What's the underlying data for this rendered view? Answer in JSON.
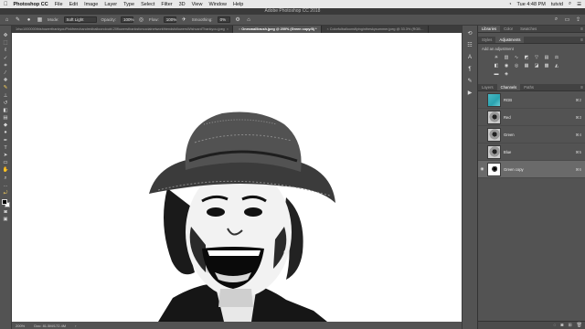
{
  "menubar": {
    "app": "Photoshop CC",
    "items": [
      "File",
      "Edit",
      "Image",
      "Layer",
      "Type",
      "Select",
      "Filter",
      "3D",
      "View",
      "Window",
      "Help"
    ],
    "clock": "Tue 4:48 PM",
    "user": "tutvid"
  },
  "window": {
    "title": "Adobe Photoshop CC 2018"
  },
  "options": {
    "mode_label": "Mode:",
    "mode_value": "Soft Light",
    "opacity_label": "Opacity:",
    "opacity_value": "100%",
    "flow_label": "Flow:",
    "flow_value": "100%",
    "smoothing_label": "Smoothing:",
    "smoothing_value": "0%"
  },
  "tabs": [
    {
      "label": "1rlsc1000000thishowerthankyouPinkfreechandredballoondoubl.20flowersthanksforsocialnetworkfriendsfollowersWishcardThankyou.jpeg",
      "active": false
    },
    {
      "label": "Onesmallbrush.jpeg @ 200% (Green copy/8) *",
      "active": true
    },
    {
      "label": "Colorfulballoonsflyingintheskysummer.jpeg @ 33.3% (RGB…",
      "active": false
    }
  ],
  "status": {
    "zoom": "200%",
    "doc": "Doc: 81.5M/172.4M"
  },
  "panels": {
    "top_tabs": [
      "Libraries",
      "Color",
      "Swatches"
    ],
    "mid_tabs": [
      "Styles",
      "Adjustments"
    ],
    "adjustments_title": "Add an adjustment",
    "adjustment_icons": [
      "brightness-icon",
      "levels-icon",
      "curves-icon",
      "exposure-icon",
      "vibrance-icon",
      "hue-icon",
      "color-balance-icon",
      "bw-icon",
      "photo-filter-icon",
      "channel-mixer-icon",
      "color-lookup-icon",
      "invert-icon",
      "posterize-icon",
      "threshold-icon",
      "gradient-map-icon",
      "selective-color-icon"
    ],
    "bottom_tabs": [
      "Layers",
      "Channels",
      "Paths"
    ],
    "channels": [
      {
        "name": "RGB",
        "key": "⌘2",
        "thumb": "rgb",
        "visible": false,
        "selected": false
      },
      {
        "name": "Red",
        "key": "⌘3",
        "thumb": "gray",
        "visible": false,
        "selected": false
      },
      {
        "name": "Green",
        "key": "⌘4",
        "thumb": "gray",
        "visible": false,
        "selected": false
      },
      {
        "name": "Blue",
        "key": "⌘5",
        "thumb": "gray",
        "visible": false,
        "selected": false
      },
      {
        "name": "Green copy",
        "key": "⌘6",
        "thumb": "white",
        "visible": true,
        "selected": true
      }
    ]
  },
  "colors": {
    "accent": "#2f7fd8",
    "panel": "#535353",
    "dark": "#3c3c3c"
  }
}
